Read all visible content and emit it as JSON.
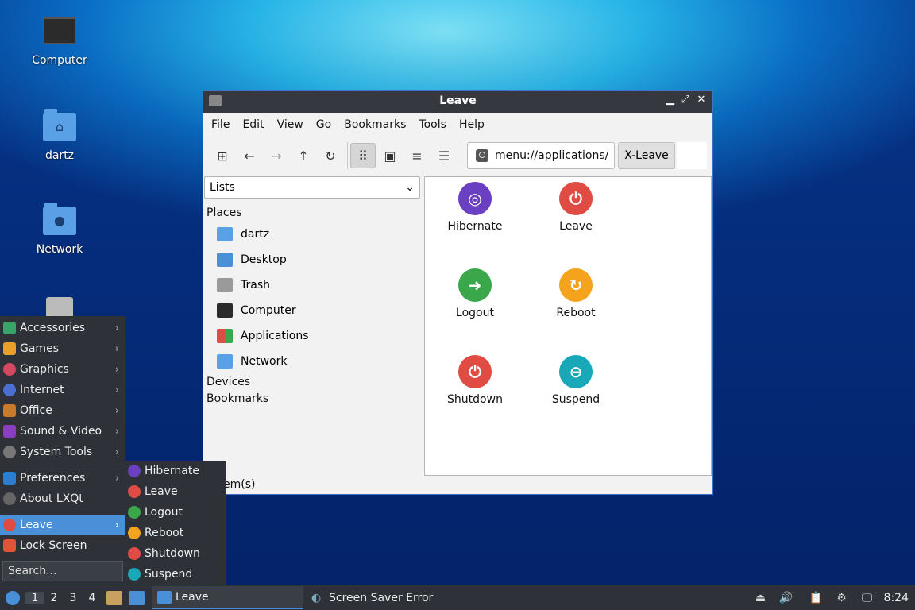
{
  "desktop": {
    "icons": [
      {
        "label": "Computer"
      },
      {
        "label": "dartz"
      },
      {
        "label": "Network"
      }
    ]
  },
  "window": {
    "title": "Leave",
    "menu": [
      "File",
      "Edit",
      "View",
      "Go",
      "Bookmarks",
      "Tools",
      "Help"
    ],
    "address": "menu://applications/",
    "breadcrumb": "X-Leave",
    "side_combo": "Lists",
    "places_header": "Places",
    "places": [
      {
        "label": "dartz"
      },
      {
        "label": "Desktop"
      },
      {
        "label": "Trash"
      },
      {
        "label": "Computer"
      },
      {
        "label": "Applications"
      },
      {
        "label": "Network"
      }
    ],
    "devices_header": "Devices",
    "bookmarks_header": "Bookmarks",
    "status": "6 item(s)",
    "status_visible": "em(s)",
    "apps": [
      {
        "label": "Hibernate",
        "color": "#6a3fc1"
      },
      {
        "label": "Leave",
        "color": "#e04b43"
      },
      {
        "label": "Logout",
        "color": "#3aa84a"
      },
      {
        "label": "Reboot",
        "color": "#f5a21c"
      },
      {
        "label": "Shutdown",
        "color": "#e04b43"
      },
      {
        "label": "Suspend",
        "color": "#19a8b8"
      }
    ]
  },
  "startmenu": {
    "items": [
      {
        "label": "Accessories",
        "color": "#3aa36a"
      },
      {
        "label": "Games",
        "color": "#e8a02a"
      },
      {
        "label": "Graphics",
        "color": "#d4495f"
      },
      {
        "label": "Internet",
        "color": "#4a6fd0"
      },
      {
        "label": "Office",
        "color": "#c97a2a"
      },
      {
        "label": "Sound & Video",
        "color": "#8a3fbf"
      },
      {
        "label": "System Tools",
        "color": "#777777"
      }
    ],
    "preferences": "Preferences",
    "about": "About LXQt",
    "leave": "Leave",
    "lock": "Lock Screen",
    "search_placeholder": "Search..."
  },
  "submenu": {
    "items": [
      {
        "label": "Hibernate",
        "color": "#6a3fc1"
      },
      {
        "label": "Leave",
        "color": "#e04b43"
      },
      {
        "label": "Logout",
        "color": "#3aa84a"
      },
      {
        "label": "Reboot",
        "color": "#f5a21c"
      },
      {
        "label": "Shutdown",
        "color": "#e04b43"
      },
      {
        "label": "Suspend",
        "color": "#19a8b8"
      }
    ]
  },
  "taskbar": {
    "workspaces": [
      "1",
      "2",
      "3",
      "4"
    ],
    "tasks": [
      {
        "label": "Leave"
      },
      {
        "label": "Screen Saver Error"
      }
    ],
    "clock": "8:24"
  }
}
